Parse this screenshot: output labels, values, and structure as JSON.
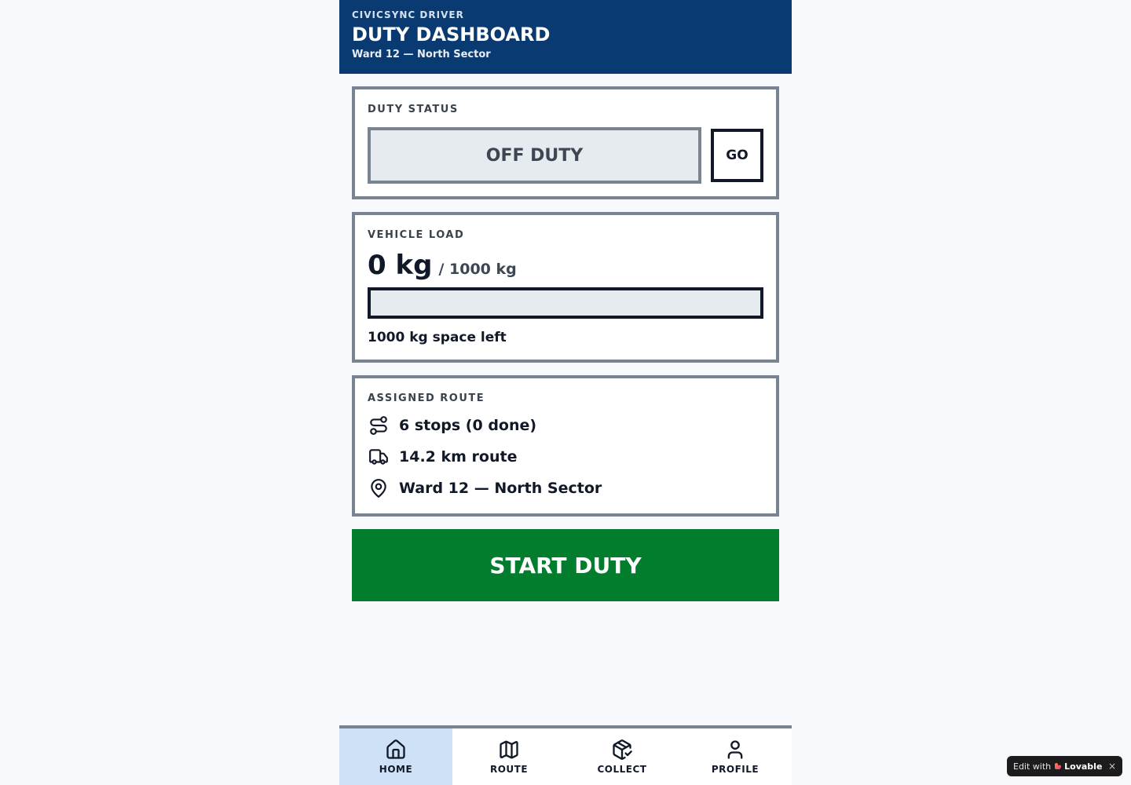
{
  "header": {
    "eyebrow": "CIVICSYNC DRIVER",
    "title": "DUTY DASHBOARD",
    "subtitle": "Ward 12 — North Sector"
  },
  "duty_status": {
    "label": "DUTY STATUS",
    "value": "OFF DUTY",
    "go_label": "GO"
  },
  "vehicle_load": {
    "label": "VEHICLE LOAD",
    "current": "0 kg",
    "max": "/ 1000 kg",
    "fill_fraction": 0,
    "space_left": "1000 kg space left"
  },
  "assigned_route": {
    "label": "ASSIGNED ROUTE",
    "items": [
      {
        "icon": "route-icon",
        "text": "6 stops (0 done)"
      },
      {
        "icon": "truck-icon",
        "text": "14.2 km route"
      },
      {
        "icon": "map-pin-icon",
        "text": "Ward 12 — North Sector"
      }
    ]
  },
  "start_button": "START DUTY",
  "nav": {
    "items": [
      {
        "label": "HOME",
        "icon": "home-icon",
        "active": true
      },
      {
        "label": "ROUTE",
        "icon": "map-icon",
        "active": false
      },
      {
        "label": "COLLECT",
        "icon": "package-icon",
        "active": false
      },
      {
        "label": "PROFILE",
        "icon": "user-icon",
        "active": false
      }
    ]
  },
  "badge": {
    "prefix": "Edit with",
    "brand": "Lovable",
    "close": "×"
  },
  "colors": {
    "header_bg": "#0a3a72",
    "start_button_bg": "#027d2e",
    "nav_active_bg": "#cfe1f7",
    "card_border": "#7a8491"
  }
}
